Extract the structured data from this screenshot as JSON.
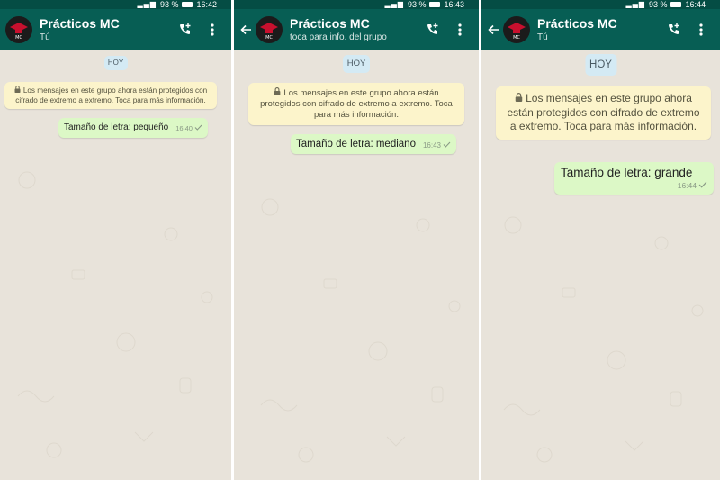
{
  "colors": {
    "appbar": "#075e54",
    "statusbar": "#054d44",
    "outgoing_bubble": "#dcf8c6",
    "e2e_notice": "#fcf4cb",
    "date_chip": "#d4eaf4",
    "wallpaper": "#e8e3da"
  },
  "panels": [
    {
      "status": {
        "signal": "▂▄▆",
        "battery_text": "93 %",
        "battery_level": 0.93,
        "time": "16:42"
      },
      "chat": {
        "title": "Prácticos MC",
        "subtitle": "Tú",
        "avatar_label": "MC"
      },
      "icons": [
        "call-add-icon",
        "more-vert-icon"
      ],
      "date_chip": "HOY",
      "e2e_notice": "Los mensajes en este grupo ahora están protegidos con cifrado de extremo a extremo. Toca para más información.",
      "message": {
        "text": "Tamaño de letra: pequeño",
        "time": "16:40"
      }
    },
    {
      "status": {
        "signal": "▂▄▆",
        "battery_text": "93 %",
        "battery_level": 0.93,
        "time": "16:43"
      },
      "chat": {
        "title": "Prácticos MC",
        "subtitle": "toca para info. del grupo",
        "avatar_label": "MC"
      },
      "icons": [
        "back-arrow-icon",
        "call-add-icon",
        "more-vert-icon"
      ],
      "date_chip": "HOY",
      "e2e_notice": "Los mensajes en este grupo ahora están protegidos con cifrado de extremo a extremo. Toca para más información.",
      "message": {
        "text": "Tamaño de letra: mediano",
        "time": "16:43"
      }
    },
    {
      "status": {
        "signal": "▂▄▆",
        "battery_text": "93 %",
        "battery_level": 0.93,
        "time": "16:44"
      },
      "chat": {
        "title": "Prácticos MC",
        "subtitle": "Tú",
        "avatar_label": "MC"
      },
      "icons": [
        "back-arrow-icon",
        "call-add-icon",
        "more-vert-icon"
      ],
      "date_chip": "HOY",
      "e2e_notice": "Los mensajes en este grupo ahora están protegidos con cifrado de extremo a extremo. Toca para más información.",
      "message": {
        "text": "Tamaño de letra: grande",
        "time": "16:44"
      }
    }
  ]
}
